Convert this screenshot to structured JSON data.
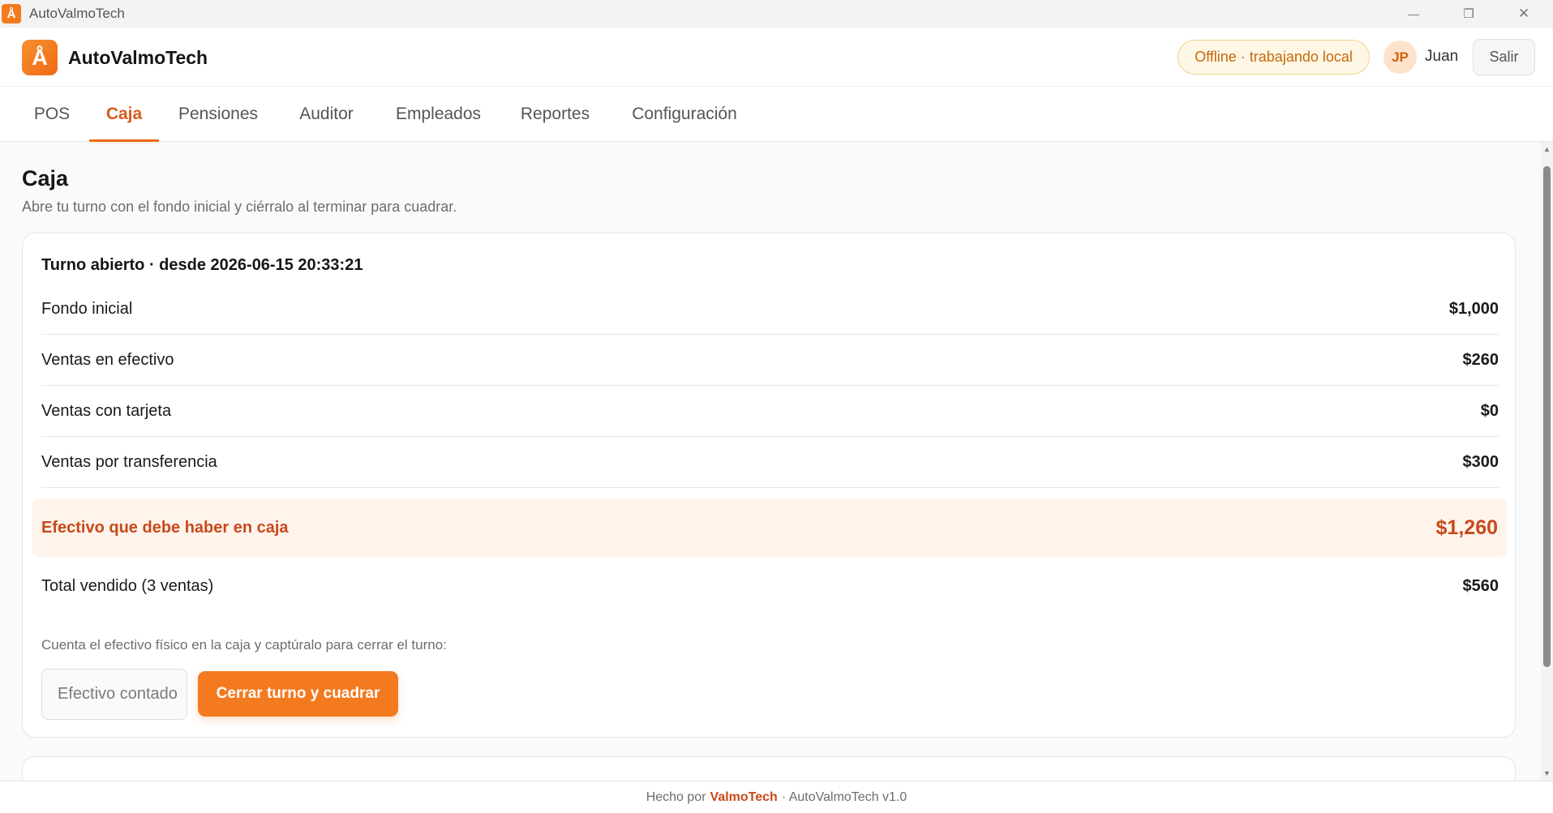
{
  "window": {
    "title": "AutoValmoTech",
    "app_icon_glyph": "Å",
    "controls": {
      "minimize": "—",
      "restore": "❐",
      "close": "✕"
    }
  },
  "header": {
    "logo_glyph": "Å",
    "brand": "AutoValmoTech",
    "status_pill": "Offline · trabajando local",
    "user_initials": "JP",
    "user_name": "Juan",
    "logout_label": "Salir"
  },
  "tabs": [
    {
      "label": "POS",
      "active": false
    },
    {
      "label": "Caja",
      "active": true
    },
    {
      "label": "Pensiones",
      "active": false
    },
    {
      "label": "Auditor",
      "active": false
    },
    {
      "label": "Empleados",
      "active": false
    },
    {
      "label": "Reportes",
      "active": false
    },
    {
      "label": "Configuración",
      "active": false
    }
  ],
  "page": {
    "title": "Caja",
    "subtitle": "Abre tu turno con el fondo inicial y ciérralo al terminar para cuadrar."
  },
  "shift": {
    "title": "Turno abierto · desde 2026-06-15 20:33:21",
    "rows": [
      {
        "label": "Fondo inicial",
        "value": "$1,000"
      },
      {
        "label": "Ventas en efectivo",
        "value": "$260"
      },
      {
        "label": "Ventas con tarjeta",
        "value": "$0"
      },
      {
        "label": "Ventas por transferencia",
        "value": "$300"
      }
    ],
    "expected": {
      "label": "Efectivo que debe haber en caja",
      "value": "$1,260"
    },
    "total": {
      "label": "Total vendido (3 ventas)",
      "value": "$560"
    },
    "hint": "Cuenta el efectivo físico en la caja y captúralo para cerrar el turno:",
    "cash_input": {
      "placeholder": "Efectivo contado",
      "value": ""
    },
    "close_button": "Cerrar turno y cuadrar"
  },
  "footer": {
    "prefix": "Hecho por",
    "brand": "ValmoTech",
    "suffix": "· AutoValmoTech v1.0"
  },
  "colors": {
    "accent": "#f47a20",
    "accent_text": "#d9591b",
    "highlight_bg": "#fff4ec",
    "pill_bg": "#fff7e6"
  }
}
